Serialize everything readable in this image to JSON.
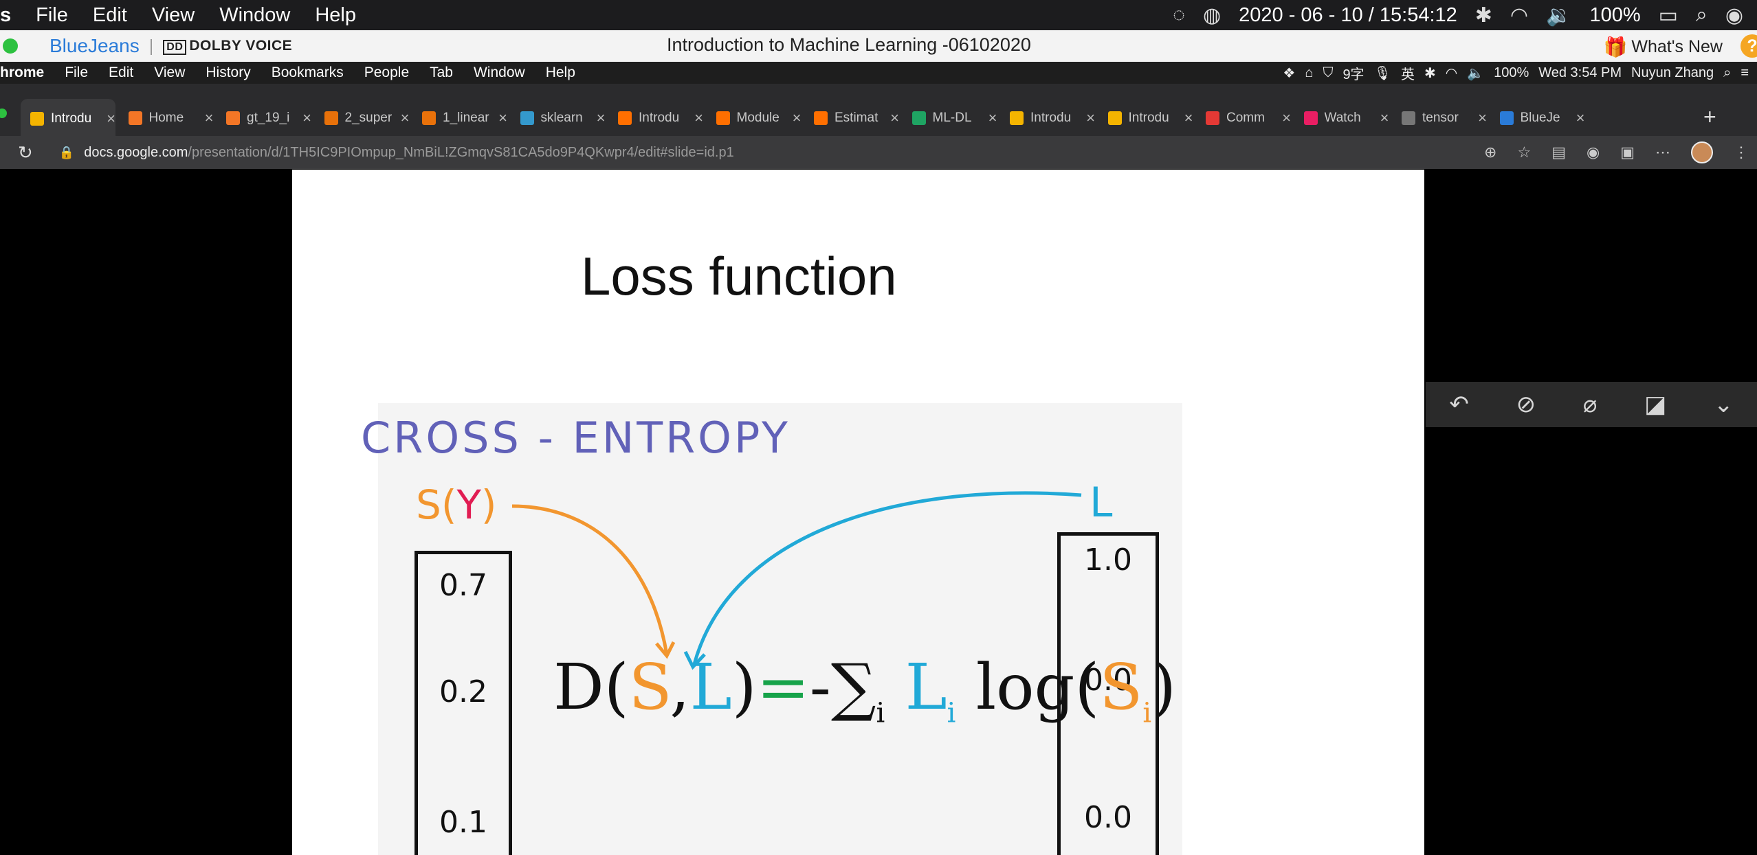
{
  "menubar": {
    "app_fragment": "s",
    "items": [
      "File",
      "Edit",
      "View",
      "Window",
      "Help"
    ],
    "datetime": "2020 - 06 - 10 / 15:54:12",
    "battery": "100%"
  },
  "bluejeans": {
    "brand": "BlueJeans",
    "dolby": "DOLBY VOICE",
    "title": "Introduction to Machine Learning -06102020",
    "whats_new": "What's New"
  },
  "chrome_menu": {
    "app_fragment": "hrome",
    "items": [
      "File",
      "Edit",
      "View",
      "History",
      "Bookmarks",
      "People",
      "Tab",
      "Window",
      "Help"
    ],
    "status_ime": "9字",
    "status_lang": "英",
    "battery": "100%",
    "clock": "Wed 3:54 PM",
    "user": "Nuyun Zhang"
  },
  "tabs": [
    {
      "label": "Introdu",
      "color": "#f4b400",
      "active": true
    },
    {
      "label": "Home",
      "color": "#f37626",
      "active": false
    },
    {
      "label": "gt_19_i",
      "color": "#f37626",
      "active": false
    },
    {
      "label": "2_super",
      "color": "#e8710a",
      "active": false
    },
    {
      "label": "1_linear",
      "color": "#e8710a",
      "active": false
    },
    {
      "label": "sklearn",
      "color": "#3499cd",
      "active": false
    },
    {
      "label": "Introdu",
      "color": "#ff6f00",
      "active": false
    },
    {
      "label": "Module",
      "color": "#ff6f00",
      "active": false
    },
    {
      "label": "Estimat",
      "color": "#ff6f00",
      "active": false
    },
    {
      "label": "ML-DL",
      "color": "#1fa463",
      "active": false
    },
    {
      "label": "Introdu",
      "color": "#f4b400",
      "active": false
    },
    {
      "label": "Introdu",
      "color": "#f4b400",
      "active": false
    },
    {
      "label": "Comm",
      "color": "#e53935",
      "active": false
    },
    {
      "label": "Watch",
      "color": "#e91e63",
      "active": false
    },
    {
      "label": "tensor",
      "color": "#777777",
      "active": false
    },
    {
      "label": "BlueJe",
      "color": "#2a7bd8",
      "active": false
    }
  ],
  "address": {
    "host": "docs.google.com",
    "path": "/presentation/d/1TH5IC9PIOmpup_NmBiL!ZGmqvS81CA5do9P4QKwpr4/edit#slide=id.p1"
  },
  "slide": {
    "title": "Loss function",
    "cross_entropy": "CROSS - ENTROPY",
    "s_label": "S(",
    "y_label": "Y",
    "s_close": ")",
    "l_label": "L",
    "left_vector": [
      "0.7",
      "0.2",
      "0.1"
    ],
    "right_vector": [
      "1.0",
      "0.0",
      "0.0"
    ],
    "formula": {
      "d": "D(",
      "s": "S",
      "comma": ",",
      "l": "L",
      "close": ")",
      "eq": "=",
      "rest": "-∑",
      "sub_i": "i",
      "li": "L",
      "li_sub": "i",
      "log": "log(",
      "si": "S",
      "si_sub": "i",
      "end": ")"
    }
  }
}
